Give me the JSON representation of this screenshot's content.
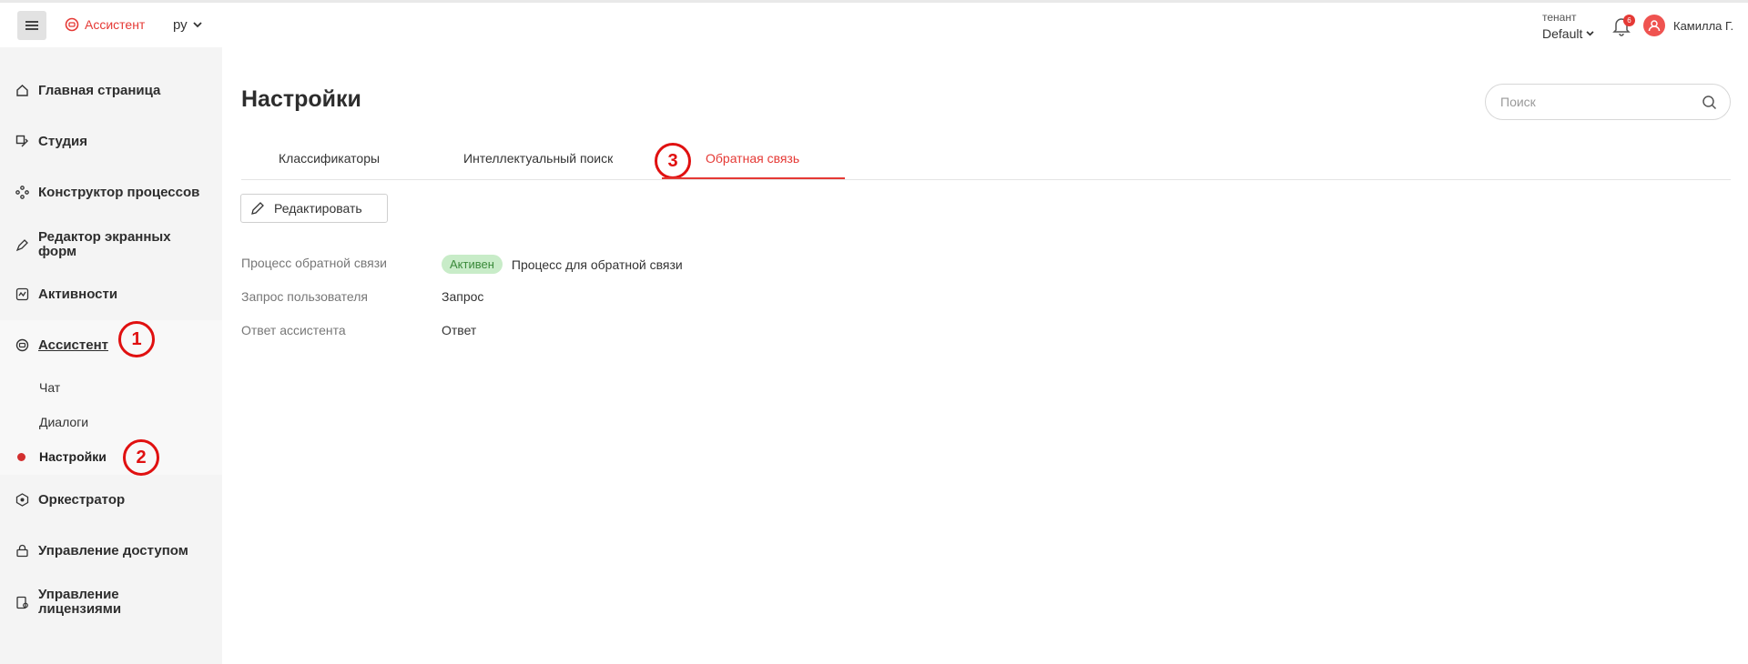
{
  "header": {
    "brand_label": "Ассистент",
    "language": "ру",
    "tenant_label": "тенант",
    "tenant_value": "Default",
    "notifications_count": "6",
    "user_name": "Камилла Г."
  },
  "sidebar": {
    "items": [
      {
        "label": "Главная страница",
        "icon": "home-icon"
      },
      {
        "label": "Студия",
        "icon": "studio-icon"
      },
      {
        "label": "Конструктор процессов",
        "icon": "process-icon"
      },
      {
        "label": "Редактор экранных форм",
        "icon": "form-editor-icon"
      },
      {
        "label": "Активности",
        "icon": "activity-icon"
      },
      {
        "label": "Ассистент",
        "icon": "assistant-icon"
      },
      {
        "label": "Оркестратор",
        "icon": "orchestrator-icon"
      },
      {
        "label": "Управление доступом",
        "icon": "access-icon"
      },
      {
        "label": "Управление лицензиями",
        "icon": "license-icon"
      }
    ],
    "assistant_sub": [
      {
        "label": "Чат"
      },
      {
        "label": "Диалоги"
      },
      {
        "label": "Настройки"
      }
    ]
  },
  "markers": [
    "1",
    "2",
    "3"
  ],
  "main": {
    "title": "Настройки",
    "search_placeholder": "Поиск",
    "tabs": [
      {
        "label": "Классификаторы"
      },
      {
        "label": "Интеллектуальный поиск"
      },
      {
        "label": "Обратная связь"
      }
    ],
    "edit_label": "Редактировать",
    "rows": [
      {
        "label": "Процесс обратной связи",
        "status": "Активен",
        "value": "Процесс для обратной связи"
      },
      {
        "label": "Запрос пользователя",
        "value": "Запрос"
      },
      {
        "label": "Ответ ассистента",
        "value": "Ответ"
      }
    ]
  },
  "colors": {
    "accent": "#e53935",
    "sidebar_bg": "#f4f4f4",
    "status_bg": "#c8ecc8",
    "marker": "#e01010"
  }
}
